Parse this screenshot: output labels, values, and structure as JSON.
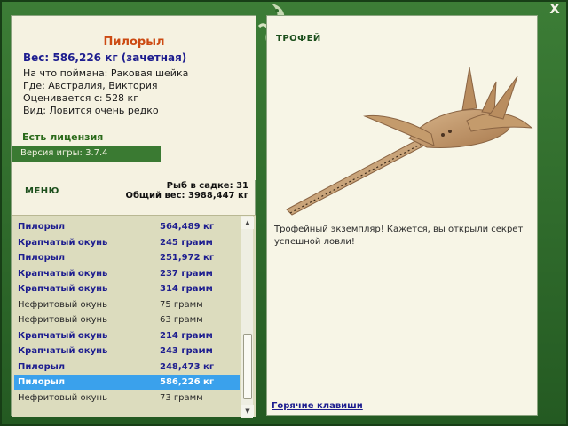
{
  "window": {
    "close_label": "X"
  },
  "fish_info": {
    "title": "Пилорыл",
    "weight_line": "Вес: 586,226 кг (зачетная)",
    "caught_on": "На что поймана: Раковая шейка",
    "location": "Где: Австралия, Виктория",
    "value": "Оценивается с: 528 кг",
    "rarity": "Вид: Ловится очень редко",
    "license": "Есть лицензия",
    "version": "Версия игры: 3.7.4"
  },
  "menu_label": "МЕНЮ",
  "keepnet": {
    "count_label": "Рыб в садке: 31",
    "total_label": "Общий вес: 3988,447 кг"
  },
  "catch_list": [
    {
      "name": "Пилорыл",
      "weight": "564,489 кг",
      "style": "bold"
    },
    {
      "name": "Крапчатый окунь",
      "weight": "245 грамм",
      "style": "bold"
    },
    {
      "name": "Пилорыл",
      "weight": "251,972 кг",
      "style": "bold"
    },
    {
      "name": "Крапчатый окунь",
      "weight": "237 грамм",
      "style": "bold"
    },
    {
      "name": "Крапчатый окунь",
      "weight": "314 грамм",
      "style": "bold"
    },
    {
      "name": "Нефритовый окунь",
      "weight": "75 грамм",
      "style": "plain"
    },
    {
      "name": "Нефритовый окунь",
      "weight": "63 грамм",
      "style": "plain"
    },
    {
      "name": "Крапчатый окунь",
      "weight": "214 грамм",
      "style": "bold"
    },
    {
      "name": "Крапчатый окунь",
      "weight": "243 грамм",
      "style": "bold"
    },
    {
      "name": "Пилорыл",
      "weight": "248,473 кг",
      "style": "bold"
    },
    {
      "name": "Пилорыл",
      "weight": "586,226 кг",
      "style": "selected"
    },
    {
      "name": "Нефритовый окунь",
      "weight": "73 грамм",
      "style": "plain"
    }
  ],
  "trophy": {
    "label": "ТРОФЕЙ",
    "text": "Трофейный экземпляр! Кажется, вы открыли секрет успешной ловли!"
  },
  "hotkeys_label": "Горячие клавиши",
  "icons": [
    "close-icon",
    "lizard-emblem-icon",
    "sawfish-image",
    "scroll-up-icon",
    "scroll-down-icon"
  ],
  "colors": {
    "frame_green": "#2e6b2a",
    "title_orange": "#cc4a12",
    "text_navy": "#1d1d8f",
    "selection_blue": "#3aa1ec",
    "panel_cream": "#f5f2e1",
    "list_bg": "#dcdcbe"
  }
}
